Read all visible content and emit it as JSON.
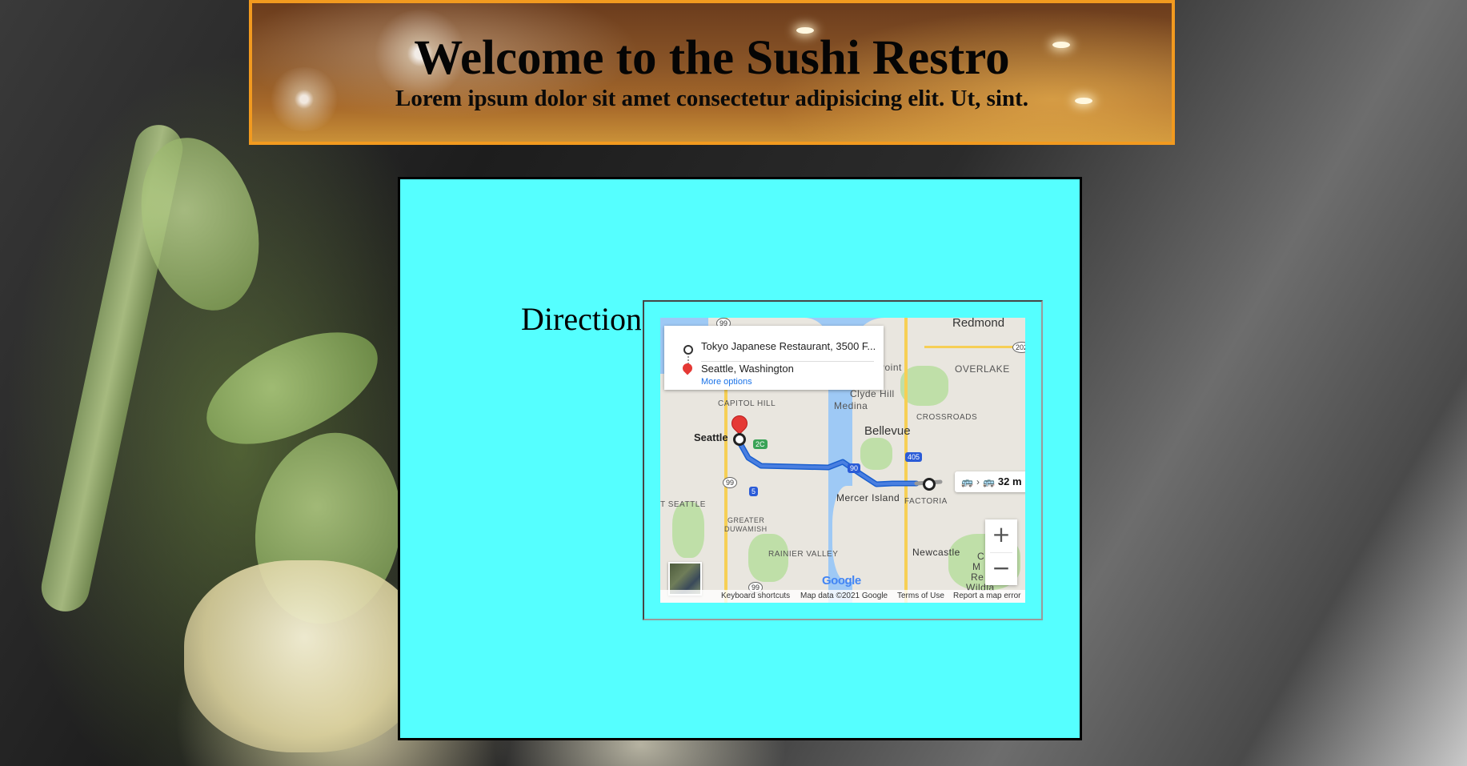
{
  "banner": {
    "title": "Welcome to the Sushi Restro",
    "subtitle": "Lorem ipsum dolor sit amet consectetur adipisicing elit. Ut, sint."
  },
  "content": {
    "directions_label": "Directions"
  },
  "map": {
    "route_card": {
      "origin": "Tokyo Japanese Restaurant, 3500 F...",
      "destination": "Seattle, Washington",
      "more_options": "More options"
    },
    "places": {
      "redmond": "Redmond",
      "point": "Point",
      "overlake": "OVERLAKE",
      "capitol_hill": "CAPITOL HILL",
      "clyde_hill": "Clyde Hill",
      "medina": "Medina",
      "crossroads": "CROSSROADS",
      "bellevue": "Bellevue",
      "seattle": "Seattle",
      "mercer_island": "Mercer Island",
      "factoria": "FACTORIA",
      "west_seattle": "T SEATTLE",
      "greater_duwamish": "GREATER",
      "duwamish": "DUWAMISH",
      "rainier_valley": "RAINIER VALLEY",
      "newcastle": "Newcastle",
      "cougar_partial": "C",
      "mountains_partial": "M",
      "regional_partial": "Re",
      "wildland_partial": "Wildla"
    },
    "highway_badges": {
      "h202": "202",
      "h2c": "2C",
      "h405": "405",
      "h90": "90",
      "h99a": "99",
      "h5": "5",
      "h99b": "99",
      "h99c": "99"
    },
    "transit": {
      "time": "32 m"
    },
    "zoom_in": "+",
    "zoom_out": "−",
    "google_logo": "Google",
    "attribution": {
      "keyboard_shortcuts": "Keyboard shortcuts",
      "map_data": "Map data ©2021 Google",
      "terms": "Terms of Use",
      "report": "Report a map error"
    }
  },
  "colors": {
    "banner_border": "#f29a1f",
    "content_background": "#55ffff",
    "route_line": "#4a7fe0",
    "map_water": "#9ec9f5",
    "link_blue": "#1a73e8"
  }
}
